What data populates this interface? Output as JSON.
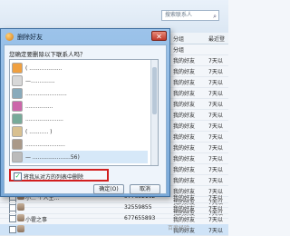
{
  "background": {
    "search_placeholder": "搜索联系人",
    "columns": {
      "group": "分组",
      "last": "最近登"
    },
    "rows": [
      {
        "group": "分组",
        "last": ""
      },
      {
        "group": "我的好友",
        "last": "7天以"
      },
      {
        "group": "我的好友",
        "last": "7天以"
      },
      {
        "group": "我的好友",
        "last": "7天以"
      },
      {
        "group": "我的好友",
        "last": "7天以"
      },
      {
        "group": "我的好友",
        "last": "7天以"
      },
      {
        "group": "我的好友",
        "last": "7天以"
      },
      {
        "group": "我的好友",
        "last": "7天以"
      },
      {
        "group": "我的好友",
        "last": "7天以"
      },
      {
        "group": "我的好友",
        "last": "7天以"
      },
      {
        "group": "我的好友",
        "last": "7天以"
      },
      {
        "group": "我的好友",
        "last": "7天以"
      },
      {
        "group": "我的好友",
        "last": "7天以"
      },
      {
        "group": "我的好友",
        "last": "7天以"
      },
      {
        "group": "我的好友",
        "last": "7天以"
      },
      {
        "group": "我的好友",
        "last": "7天以"
      }
    ],
    "bottom_rows": [
      {
        "name": "小... 个人主... ",
        "num": "577652162",
        "group": "我的好友",
        "last": "7天以"
      },
      {
        "name": "",
        "num": "32559855",
        "group": "我的好友",
        "last": "7天以"
      },
      {
        "name": "小霍之事",
        "num": "677655893",
        "group": "我的好友",
        "last": "7天以"
      },
      {
        "name": "",
        "num": "",
        "group": "我的好友",
        "last": "7天以"
      }
    ]
  },
  "dialog": {
    "title": "删除好友",
    "close_label": "✕",
    "question": "您确定要删除以下联系人吗？",
    "items": [
      {
        "text": "( ...................",
        "color": "#f0a040"
      },
      {
        "text": "—..............",
        "color": "#d8d8d8"
      },
      {
        "text": "........................",
        "color": "#8ab"
      },
      {
        "text": "................",
        "color": "#c6a"
      },
      {
        "text": "......................",
        "color": "#7a9"
      },
      {
        "text": "( ........... )",
        "color": "#d8c090"
      },
      {
        "text": ".......................",
        "color": "#a98"
      },
      {
        "text": "— ......................56)",
        "color": "#bbb"
      }
    ],
    "remove_from_list_label": "将我从对方的列表中删除",
    "remove_from_list_checked": true,
    "ok_label": "确定(O)",
    "cancel_label": "取消"
  },
  "watermark": "百度经验"
}
